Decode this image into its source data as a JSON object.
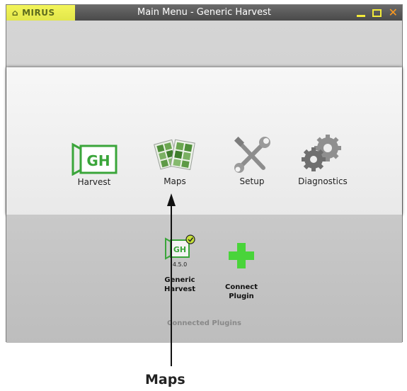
{
  "window": {
    "brand": "MIRUS",
    "title": "Main Menu - Generic Harvest",
    "buttons": {
      "minimize": "minimize",
      "maximize": "maximize",
      "close": "close"
    }
  },
  "menu": {
    "items": [
      {
        "label": "Harvest",
        "icon": "gh-logo-icon",
        "badge": "GH"
      },
      {
        "label": "Maps",
        "icon": "maps-icon"
      },
      {
        "label": "Setup",
        "icon": "wrench-screwdriver-icon"
      },
      {
        "label": "Diagnostics",
        "icon": "gears-icon"
      }
    ]
  },
  "plugins": {
    "items": [
      {
        "name_line1": "Generic",
        "name_line2": "Harvest",
        "version": "4.5.0",
        "badge": "GH",
        "icon": "gh-plugin-icon",
        "status_icon": "check-circle-icon"
      },
      {
        "name_line1": "Connect",
        "name_line2": "Plugin",
        "icon": "green-plus-icon"
      }
    ],
    "section_label": "Connected Plugins"
  },
  "callout": {
    "label": "Maps"
  },
  "colors": {
    "brand_yellow": "#e8eb4e",
    "accent_green": "#3aa53a",
    "plus_green": "#49d43a",
    "close_orange": "#ff9a1e"
  }
}
